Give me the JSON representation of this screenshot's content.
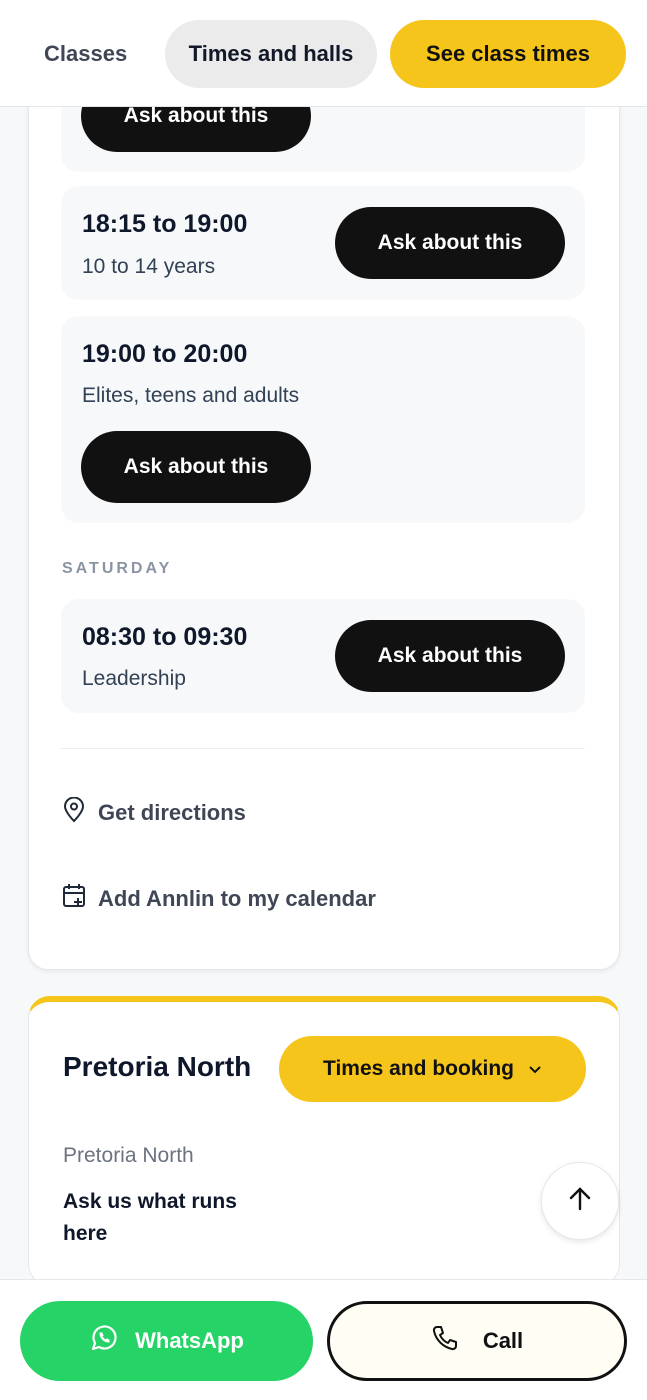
{
  "nav": {
    "classes": "Classes",
    "times_and_halls": "Times and halls",
    "cta": "See class times"
  },
  "schedule": {
    "ask_label": "Ask about this",
    "slots_before": [
      {
        "time": "18:15 to 19:00",
        "label": "10 to 14 years"
      },
      {
        "time": "19:00 to 20:00",
        "label": "Elites, teens and adults"
      }
    ],
    "saturday": {
      "day": "SATURDAY",
      "slots": [
        {
          "time": "08:30 to 09:30",
          "label": "Leadership"
        }
      ]
    }
  },
  "links": {
    "directions": "Get directions",
    "calendar": "Add Annlin to my calendar"
  },
  "venue": {
    "title": "Pretoria North",
    "subtitle": "Pretoria North",
    "ask": "Ask us what runs here",
    "booking": "Times and booking"
  },
  "bottom": {
    "whatsapp": "WhatsApp",
    "call": "Call"
  },
  "colors": {
    "accent_yellow": "#f6c51b",
    "whatsapp_green": "#25d366",
    "dark_button": "#111111"
  },
  "icons": [
    "location-pin-icon",
    "calendar-add-icon",
    "chevron-down-icon",
    "arrow-up-icon",
    "whatsapp-icon",
    "phone-icon"
  ]
}
